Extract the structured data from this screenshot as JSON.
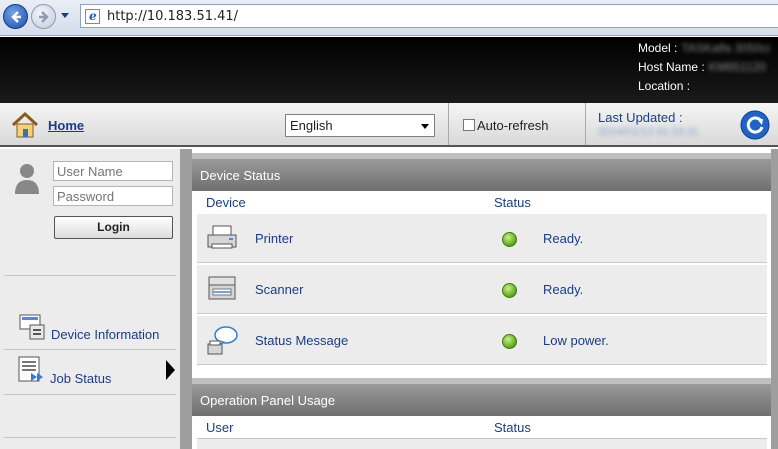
{
  "browser": {
    "address": "http://10.183.51.41/"
  },
  "header": {
    "model_label": "Model :",
    "model_value": "TASKalfa 3050ci",
    "host_label": "Host Name :",
    "host_value": "KM651120",
    "location_label": "Location :"
  },
  "toolbar": {
    "home_label": "Home",
    "language": "English",
    "auto_refresh_label": "Auto-refresh",
    "auto_refresh_checked": false,
    "last_updated_label": "Last Updated :",
    "last_updated_value": "2014/01/13 01:33:31"
  },
  "sidebar": {
    "username_placeholder": "User Name",
    "password_placeholder": "Password",
    "login_label": "Login",
    "items": [
      {
        "label": "Device Information",
        "icon": "device-info-icon"
      },
      {
        "label": "Job Status",
        "icon": "job-status-icon"
      }
    ]
  },
  "device_status": {
    "title": "Device Status",
    "col_device": "Device",
    "col_status": "Status",
    "rows": [
      {
        "device": "Printer",
        "status": "Ready.",
        "icon": "printer-icon",
        "indicator": "#5aa512"
      },
      {
        "device": "Scanner",
        "status": "Ready.",
        "icon": "scanner-icon",
        "indicator": "#5aa512"
      },
      {
        "device": "Status Message",
        "status": "Low power.",
        "icon": "status-message-icon",
        "indicator": "#5aa512"
      }
    ]
  },
  "operation_panel": {
    "title": "Operation Panel Usage",
    "col_user": "User",
    "col_status": "Status"
  }
}
